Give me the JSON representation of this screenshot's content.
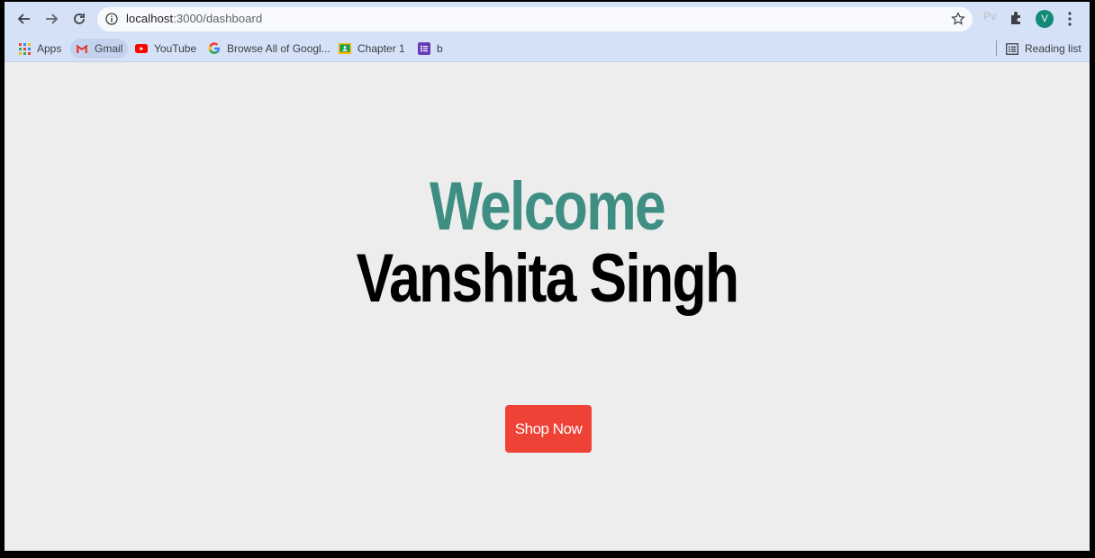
{
  "browser": {
    "url_host": "localhost",
    "url_path": ":3000/dashboard",
    "extension_label": "Pv",
    "avatar_letter": "V",
    "avatar_color": "#148a76"
  },
  "bookmarks": {
    "items": [
      {
        "label": "Apps",
        "icon": "apps-grid-icon"
      },
      {
        "label": "Gmail",
        "icon": "gmail-icon"
      },
      {
        "label": "YouTube",
        "icon": "youtube-icon"
      },
      {
        "label": "Browse All of Googl...",
        "icon": "google-icon"
      },
      {
        "label": "Chapter 1",
        "icon": "classroom-icon"
      },
      {
        "label": "b",
        "icon": "forms-icon"
      }
    ],
    "reading_list": "Reading list"
  },
  "page": {
    "welcome": "Welcome",
    "username": "Vanshita Singh",
    "shop_button": "Shop Now",
    "colors": {
      "welcome": "#3f8e83",
      "button": "#ee4237",
      "background": "#ededed"
    }
  }
}
